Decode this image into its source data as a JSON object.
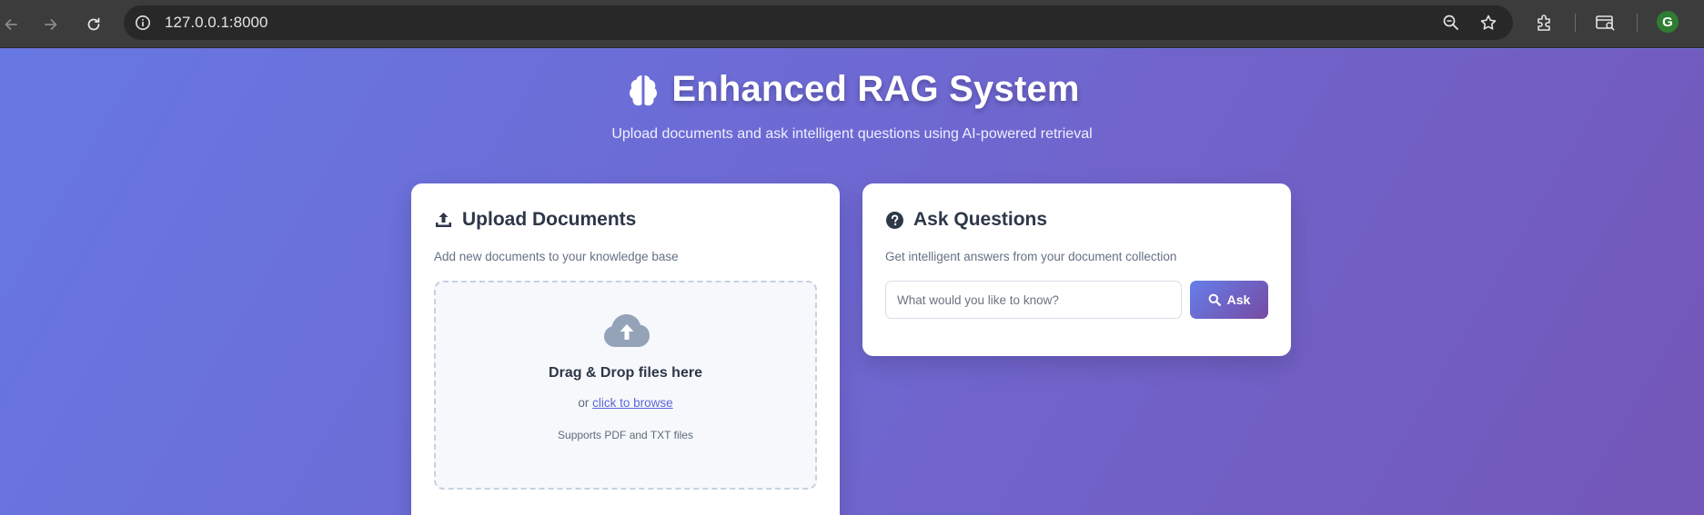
{
  "browser": {
    "url": "127.0.0.1:8000",
    "profile_initial": "G"
  },
  "header": {
    "title": "Enhanced RAG System",
    "subtitle": "Upload documents and ask intelligent questions using AI-powered retrieval"
  },
  "upload": {
    "title": "Upload Documents",
    "description": "Add new documents to your knowledge base",
    "drop_title": "Drag & Drop files here",
    "or_text": "or ",
    "browse_link": "click to browse",
    "support_text": "Supports PDF and TXT files"
  },
  "ask": {
    "title": "Ask Questions",
    "description": "Get intelligent answers from your document collection",
    "input_placeholder": "What would you like to know?",
    "input_value": "",
    "button_label": "Ask"
  },
  "icons": {
    "back": "arrow-left-icon",
    "forward": "arrow-right-icon",
    "reload": "reload-icon",
    "site_info": "info-icon",
    "zoom": "zoom-out-icon",
    "bookmark": "star-icon",
    "extensions": "puzzle-icon",
    "tab_search": "tab-search-icon",
    "brain": "brain-icon",
    "upload": "upload-icon",
    "question": "question-circle-icon",
    "cloud": "cloud-upload-icon",
    "search": "search-icon"
  },
  "colors": {
    "accent_start": "#667eea",
    "accent_end": "#764ba2",
    "link": "#5a67d8"
  }
}
